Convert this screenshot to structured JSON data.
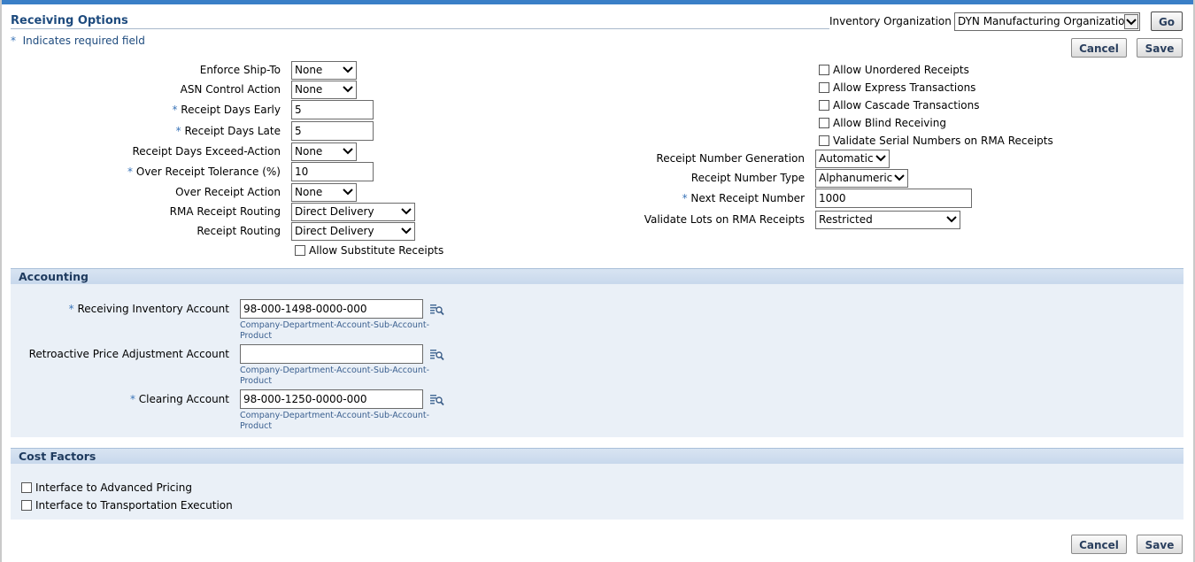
{
  "header": {
    "title": "Receiving Options",
    "required_note": "Indicates required field",
    "inventory_org_label": "Inventory Organization",
    "inventory_org_value": "DYN Manufacturing Organization",
    "go_label": "Go",
    "cancel_label": "Cancel",
    "save_label": "Save"
  },
  "left_fields": {
    "enforce_ship_to": {
      "label": "Enforce Ship-To",
      "value": "None"
    },
    "asn_control_action": {
      "label": "ASN Control Action",
      "value": "None"
    },
    "receipt_days_early": {
      "label": "Receipt Days Early",
      "value": "5",
      "required": true
    },
    "receipt_days_late": {
      "label": "Receipt Days Late",
      "value": "5",
      "required": true
    },
    "receipt_days_exceed_action": {
      "label": "Receipt Days Exceed-Action",
      "value": "None"
    },
    "over_receipt_tolerance": {
      "label": "Over Receipt Tolerance (%)",
      "value": "10",
      "required": true
    },
    "over_receipt_action": {
      "label": "Over Receipt Action",
      "value": "None"
    },
    "rma_receipt_routing": {
      "label": "RMA Receipt Routing",
      "value": "Direct Delivery"
    },
    "receipt_routing": {
      "label": "Receipt Routing",
      "value": "Direct Delivery"
    },
    "allow_substitute_receipts": {
      "label": "Allow Substitute Receipts",
      "checked": false
    }
  },
  "right_fields": {
    "checkboxes": [
      {
        "label": "Allow Unordered Receipts",
        "checked": false
      },
      {
        "label": "Allow Express Transactions",
        "checked": false
      },
      {
        "label": "Allow Cascade Transactions",
        "checked": false
      },
      {
        "label": "Allow Blind Receiving",
        "checked": false
      },
      {
        "label": "Validate Serial Numbers on RMA Receipts",
        "checked": false
      }
    ],
    "receipt_number_generation": {
      "label": "Receipt Number Generation",
      "value": "Automatic"
    },
    "receipt_number_type": {
      "label": "Receipt Number Type",
      "value": "Alphanumeric"
    },
    "next_receipt_number": {
      "label": "Next Receipt Number",
      "value": "1000",
      "required": true
    },
    "validate_lots_rma": {
      "label": "Validate Lots on RMA Receipts",
      "value": "Restricted"
    }
  },
  "accounting": {
    "title": "Accounting",
    "receiving_inventory_account": {
      "label": "Receiving Inventory Account",
      "value": "98-000-1498-0000-000",
      "required": true,
      "hint_line1": "Company-Department-Account-Sub-Account-",
      "hint_line2": "Product"
    },
    "retroactive_price_adjustment_account": {
      "label": "Retroactive Price Adjustment Account",
      "value": "",
      "hint_line1": "Company-Department-Account-Sub-Account-",
      "hint_line2": "Product"
    },
    "clearing_account": {
      "label": "Clearing Account",
      "value": "98-000-1250-0000-000",
      "required": true,
      "hint_line1": "Company-Department-Account-Sub-Account-",
      "hint_line2": "Product"
    }
  },
  "cost_factors": {
    "title": "Cost Factors",
    "interface_advanced_pricing": {
      "label": "Interface to Advanced Pricing",
      "checked": false
    },
    "interface_transportation_execution": {
      "label": "Interface to Transportation Execution",
      "checked": false
    }
  },
  "colors": {
    "accent": "#3a7fc7",
    "title": "#1e4b7e",
    "section_bg": "#eaf0f7",
    "section_head": "#d0deef"
  },
  "icons": {
    "lov": "search-list-icon",
    "dropdown": "chevron-down-icon",
    "required": "asterisk"
  }
}
